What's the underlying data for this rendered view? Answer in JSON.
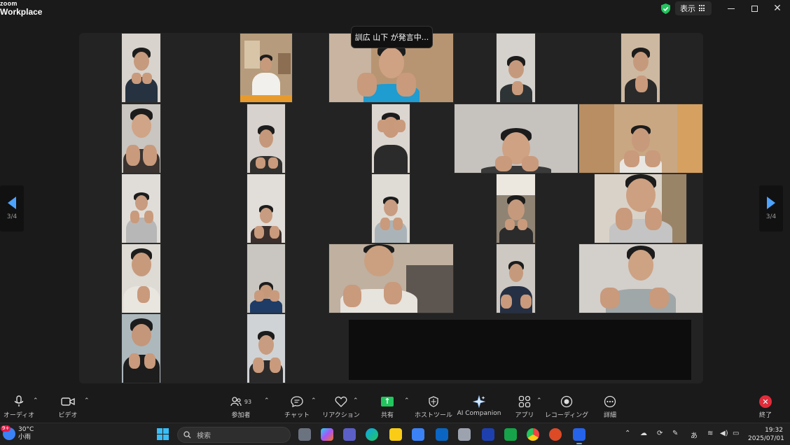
{
  "app": {
    "logo_line1": "zoom",
    "logo_line2": "Workplace"
  },
  "titlebar": {
    "view_label": "表示"
  },
  "meeting": {
    "speaker_tooltip": "訓広 山下 が発言中...",
    "page_left": "3/4",
    "page_right": "3/4"
  },
  "toolbar": {
    "audio": "オーディオ",
    "video": "ビデオ",
    "participants": "参加者",
    "participants_count": "93",
    "chat": "チャット",
    "reactions": "リアクション",
    "share": "共有",
    "host_tools": "ホストツール",
    "ai_companion": "AI Companion",
    "apps": "アプリ",
    "recording": "レコーディング",
    "more": "詳細",
    "end": "終了"
  },
  "taskbar": {
    "weather_temp": "30°C",
    "weather_desc": "小雨",
    "weather_badge": "9+",
    "search_placeholder": "検索",
    "ime": "あ",
    "time": "19:32",
    "date": "2025/07/01"
  },
  "colors": {
    "accent": "#4da3ff",
    "share": "#22c55e",
    "end": "#e02d3c"
  }
}
